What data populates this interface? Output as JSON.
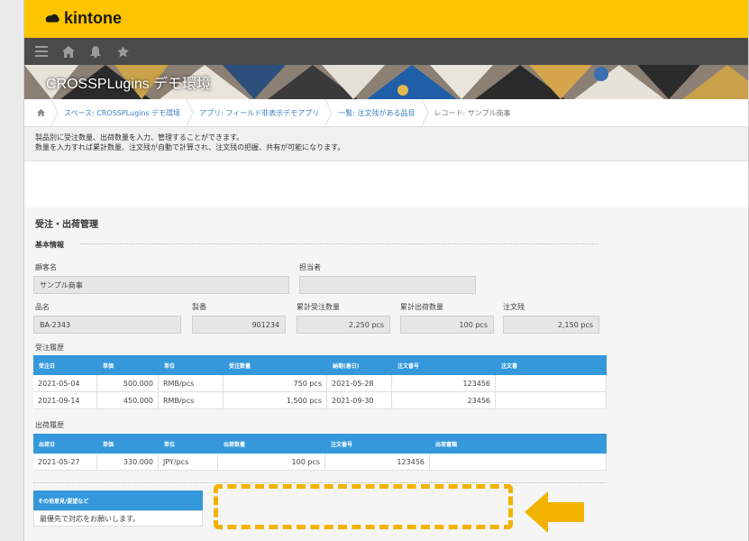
{
  "app": {
    "brand": "kintone"
  },
  "colors": {
    "brand": "#fdc400",
    "navbar": "#4b4b4b",
    "table_header": "#3498db",
    "highlight": "#f2b300"
  },
  "navbar": {
    "icons": [
      "menu-icon",
      "home-icon",
      "bell-icon",
      "star-icon"
    ]
  },
  "banner": {
    "title": "CROSSPLugins デモ環境"
  },
  "breadcrumb": {
    "items": [
      "スペース: CROSSPLugins デモ環境",
      "アプリ: フィールド非表示デモアプリ",
      "一覧: 注文残がある品目",
      "レコード: サンプル商事"
    ]
  },
  "description": {
    "line1": "製品別に受注数量、出荷数量を入力、管理することができます。",
    "line2": "数量を入力すれば累計数量、注文残が自動で計算され、注文残の把握、共有が可能になります。"
  },
  "form": {
    "title": "受注・出荷管理",
    "basic_info": "基本情報",
    "customer_label": "顧客名",
    "customer_value": "サンプル商事",
    "staff_label": "担当者",
    "staff_value": "",
    "product_label": "品名",
    "product_value": "BA-2343",
    "serial_label": "製番",
    "serial_value": "901234",
    "total_order_label": "累計受注数量",
    "total_order_value": "2,250 pcs",
    "total_ship_label": "累計出荷数量",
    "total_ship_value": "100 pcs",
    "backorder_label": "注文残",
    "backorder_value": "2,150 pcs",
    "order_history_label": "受注履歴",
    "order_table": {
      "headers": [
        "受注日",
        "単価",
        "単位",
        "受注数量",
        "納期(着日)",
        "注文番号",
        "注文書"
      ],
      "rows": [
        [
          "2021-05-04",
          "500.000",
          "RMB/pcs",
          "750 pcs",
          "2021-05-28",
          "123456",
          ""
        ],
        [
          "2021-09-14",
          "450.000",
          "RMB/pcs",
          "1,500 pcs",
          "2021-09-30",
          "23456",
          ""
        ]
      ]
    },
    "ship_history_label": "出荷履歴",
    "ship_table": {
      "headers": [
        "出荷日",
        "単価",
        "単位",
        "出荷数量",
        "注文番号",
        "出荷書類"
      ],
      "rows": [
        [
          "2021-05-27",
          "330.000",
          "JPY/pcs",
          "100 pcs",
          "123456",
          ""
        ]
      ]
    },
    "notes_label": "その他意見/要望など",
    "notes_value": "最優先で対応をお願いします。"
  }
}
